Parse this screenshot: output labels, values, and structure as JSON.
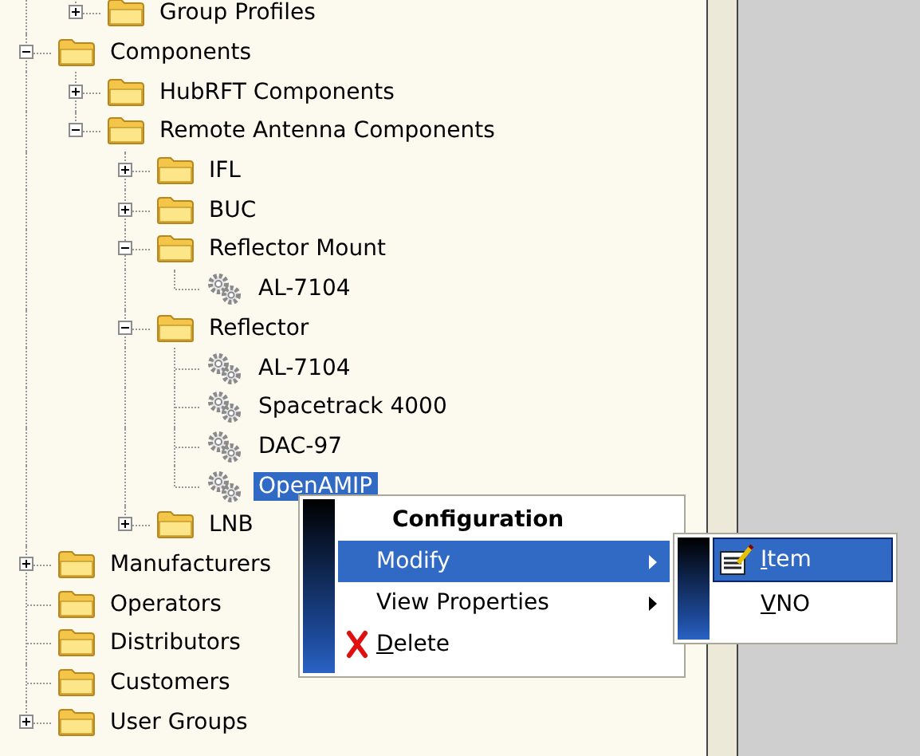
{
  "tree": {
    "items": [
      {
        "children": [
          {
            "label": "Group Profiles",
            "kind": "folder",
            "expanded": false,
            "selected": false
          }
        ]
      },
      {
        "label": "Components",
        "kind": "folder",
        "expanded": true,
        "selected": false,
        "children": [
          {
            "label": "HubRFT Components",
            "kind": "folder",
            "expanded": false,
            "selected": false
          },
          {
            "label": "Remote Antenna Components",
            "kind": "folder",
            "expanded": true,
            "selected": false,
            "children": [
              {
                "label": "IFL",
                "kind": "folder",
                "expanded": false,
                "selected": false
              },
              {
                "label": "BUC",
                "kind": "folder",
                "expanded": false,
                "selected": false
              },
              {
                "label": "Reflector Mount",
                "kind": "folder",
                "expanded": true,
                "selected": false,
                "children": [
                  {
                    "label": "AL-7104",
                    "kind": "gear",
                    "selected": false
                  }
                ]
              },
              {
                "label": "Reflector",
                "kind": "folder",
                "expanded": true,
                "selected": false,
                "children": [
                  {
                    "label": "AL-7104",
                    "kind": "gear",
                    "selected": false
                  },
                  {
                    "label": "Spacetrack 4000",
                    "kind": "gear",
                    "selected": false
                  },
                  {
                    "label": "DAC-97",
                    "kind": "gear",
                    "selected": false
                  },
                  {
                    "label": "OpenAMIP",
                    "kind": "gear",
                    "selected": true
                  }
                ]
              },
              {
                "label": "LNB",
                "kind": "folder",
                "expanded": false,
                "selected": false
              }
            ]
          }
        ]
      },
      {
        "label": "Manufacturers",
        "kind": "folder",
        "expanded": false,
        "selected": false
      },
      {
        "label": "Operators",
        "kind": "folder",
        "selected": false
      },
      {
        "label": "Distributors",
        "kind": "folder",
        "selected": false
      },
      {
        "label": "Customers",
        "kind": "folder",
        "selected": false
      },
      {
        "label": "User Groups",
        "kind": "folder",
        "expanded": false,
        "selected": false
      }
    ]
  },
  "context_menu": {
    "items": [
      {
        "kind": "title",
        "label": "Configuration"
      },
      {
        "kind": "submenu",
        "label": "Modify",
        "selected": true,
        "mnemonic": false
      },
      {
        "kind": "submenu",
        "label": "View Properties",
        "selected": false,
        "mnemonic": false
      },
      {
        "kind": "delete",
        "label": "Delete",
        "selected": false,
        "mnemonic": true
      }
    ]
  },
  "submenu": {
    "items": [
      {
        "kind": "edit",
        "label": "Item",
        "selected": true,
        "mnemonic": true
      },
      {
        "kind": "command",
        "label": "VNO",
        "selected": false,
        "mnemonic": true
      }
    ]
  }
}
